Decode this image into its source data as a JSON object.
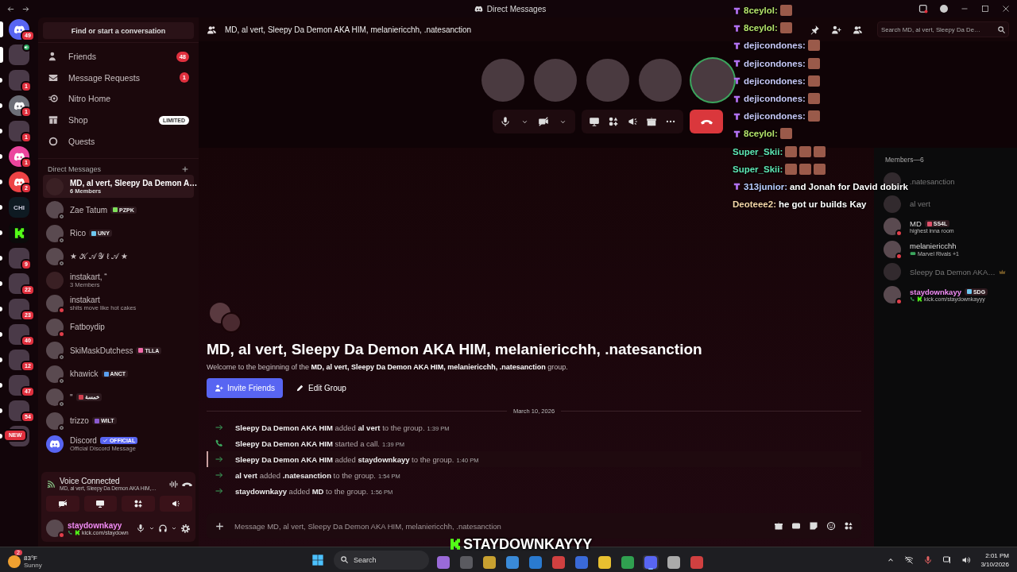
{
  "title_bar": {
    "title": "Direct Messages"
  },
  "servers": [
    {
      "kind": "logo",
      "color": "#5865f2",
      "badge": "49",
      "selected": true,
      "unread": false
    },
    {
      "kind": "picture",
      "selected": true,
      "unread": false,
      "in_voice": true
    },
    {
      "kind": "picture",
      "badge": "1",
      "selected": false,
      "unread": true
    },
    {
      "kind": "logo",
      "color": "#6d6f78",
      "badge": "1",
      "selected": false,
      "unread": true
    },
    {
      "kind": "picture",
      "badge": "1",
      "selected": false,
      "unread": true
    },
    {
      "kind": "logo",
      "color": "#eb459e",
      "badge": "1",
      "selected": false,
      "unread": true
    },
    {
      "kind": "logo",
      "color": "#ed4245",
      "badge": "2",
      "selected": false,
      "unread": true
    },
    {
      "kind": "text",
      "label": "CHI",
      "selected": false,
      "unread": true
    },
    {
      "kind": "kick",
      "selected": false,
      "unread": true
    },
    {
      "kind": "picture",
      "badge": "9",
      "selected": false,
      "unread": true
    },
    {
      "kind": "picture",
      "badge": "22",
      "selected": false,
      "unread": true
    },
    {
      "kind": "picture",
      "badge": "23",
      "selected": false,
      "unread": true
    },
    {
      "kind": "picture",
      "badge": "40",
      "selected": false,
      "unread": true
    },
    {
      "kind": "picture",
      "badge": "12",
      "selected": false,
      "unread": true
    },
    {
      "kind": "picture",
      "badge": "47",
      "selected": false,
      "unread": true
    },
    {
      "kind": "picture",
      "badge": "54",
      "selected": false,
      "unread": true
    },
    {
      "kind": "picture",
      "badge": "NEW",
      "selected": false,
      "unread": true
    }
  ],
  "sidebar": {
    "search": "Find or start a conversation",
    "nav": [
      {
        "kind": "friends",
        "label": "Friends",
        "badge": "48"
      },
      {
        "kind": "requests",
        "label": "Message Requests",
        "badge": "1"
      },
      {
        "kind": "nitro",
        "label": "Nitro Home"
      },
      {
        "kind": "shop",
        "label": "Shop",
        "tag": "LIMITED"
      },
      {
        "kind": "quests",
        "label": "Quests"
      }
    ],
    "dm_header": "Direct Messages",
    "dms": [
      {
        "name": "MD, al vert, Sleepy Da Demon A…",
        "subtitle": "6 Members",
        "group": true,
        "selected": true,
        "offline": false,
        "dnd": false
      },
      {
        "name": "Zae Tatum",
        "tag": {
          "text": "PZPK",
          "color": "#7fe05a"
        },
        "group": false,
        "selected": false,
        "offline": true,
        "dnd": false
      },
      {
        "name": "Rico",
        "tag": {
          "text": "UNY",
          "color": "#6ec8f0"
        },
        "group": false,
        "selected": false,
        "offline": true,
        "dnd": false
      },
      {
        "name": "★ 𝒦 𝒜 𝒴 ℓ 𝒜 ★",
        "group": false,
        "selected": false,
        "offline": true,
        "dnd": false
      },
      {
        "name": "instakart, “",
        "subtitle": "3 Members",
        "group": true,
        "selected": false,
        "offline": false,
        "dnd": false
      },
      {
        "name": "instakart",
        "subtitle": "shits move like hot cakes",
        "group": false,
        "selected": false,
        "offline": false,
        "dnd": true
      },
      {
        "name": "Fatboydip",
        "group": false,
        "selected": false,
        "offline": false,
        "dnd": true
      },
      {
        "name": "SkiMaskDutchess",
        "tag": {
          "text": "TLLA",
          "color": "#f06aa8"
        },
        "group": false,
        "selected": false,
        "offline": true,
        "dnd": false
      },
      {
        "name": "khawick",
        "tag": {
          "text": "ANCT",
          "color": "#5aa0f0"
        },
        "group": false,
        "selected": false,
        "offline": true,
        "dnd": false
      },
      {
        "name": "\"",
        "tag": {
          "text": "خمسة",
          "color": "#d04050"
        },
        "group": false,
        "selected": false,
        "offline": true,
        "dnd": false
      },
      {
        "name": "trizzo",
        "tag": {
          "text": "WILT",
          "color": "#8a5ad0"
        },
        "group": false,
        "selected": false,
        "offline": true,
        "dnd": false
      },
      {
        "name": "Discord",
        "official": "OFFICIAL",
        "subtitle": "Official Discord Message",
        "selected": false,
        "offline": false,
        "dnd": false
      }
    ],
    "voice": {
      "title": "Voice Connected",
      "channel": "MD, al vert, Sleepy Da Demon AKA HIM,…"
    },
    "user": {
      "name": "staydownkayy",
      "activity": "kick.com/staydown",
      "dnd": true
    }
  },
  "header": {
    "title": "MD, al vert, Sleepy Da Demon AKA HIM, melaniericchh, .natesanction",
    "search_placeholder": "Search MD, al vert, Sleepy Da De…"
  },
  "call": {
    "participants": [
      {
        "speaking": false
      },
      {
        "speaking": false
      },
      {
        "speaking": false
      },
      {
        "speaking": false
      },
      {
        "speaking": true
      }
    ],
    "camera": false
  },
  "welcome": {
    "title": "MD, al vert, Sleepy Da Demon AKA HIM, melaniericchh, .natesanction",
    "text": "Welcome to the beginning of the **MD, al vert, Sleepy Da Demon AKA HIM, melaniericchh, .natesanction** group.",
    "buttons": [
      {
        "kind": "invite",
        "label": "Invite Friends"
      },
      {
        "kind": "edit",
        "label": "Edit Group"
      }
    ]
  },
  "date_divider": "March 10, 2026",
  "messages": [
    {
      "kind": "join",
      "text": "**Sleepy Da Demon AKA HIM** added **al vert** to the group.",
      "time": "1:39 PM",
      "highlighted": false
    },
    {
      "kind": "call",
      "text": "**Sleepy Da Demon AKA HIM** started a call.",
      "time": "1:39 PM",
      "highlighted": false
    },
    {
      "kind": "join",
      "text": "**Sleepy Da Demon AKA HIM** added **staydownkayy** to the group.",
      "time": "1:40 PM",
      "highlighted": true
    },
    {
      "kind": "join",
      "text": "**al vert** added **.natesanction** to the group.",
      "time": "1:54 PM",
      "highlighted": false
    },
    {
      "kind": "join",
      "text": "**staydownkayy** added **MD** to the group.",
      "time": "1:56 PM",
      "highlighted": false
    }
  ],
  "composer": {
    "placeholder": "Message MD, al vert, Sleepy Da Demon AKA HIM, melaniericchh, .natesanction"
  },
  "members": {
    "header": "Members—6",
    "items": [
      {
        "name": ".natesanction",
        "offline": true,
        "owner": false,
        "dnd": false
      },
      {
        "name": "al vert",
        "offline": true,
        "owner": false,
        "dnd": false
      },
      {
        "name": "MD",
        "tag": {
          "text": "SS4L",
          "color": "#e0506a"
        },
        "activity": {
          "kind": "text",
          "text": "highest inna room"
        },
        "offline": false,
        "owner": false,
        "dnd": true
      },
      {
        "name": "melaniericchh",
        "activity": {
          "kind": "game",
          "text": "Marvel Rivals +1"
        },
        "offline": false,
        "owner": false,
        "dnd": true
      },
      {
        "name": "Sleepy Da Demon AKA…",
        "offline": true,
        "owner": true,
        "dnd": false
      },
      {
        "name": "staydownkayy",
        "color": "#f28cf5",
        "tag": {
          "text": "SDG",
          "color": "#6ec8f0"
        },
        "activity": {
          "kind": "stream",
          "text": "kick.com/staydownkayyy"
        },
        "offline": false,
        "owner": false,
        "dnd": true
      }
    ]
  },
  "stream_chat": [
    {
      "user": "8ceylol:",
      "color": "#b4e36b",
      "badge": true,
      "parts": [
        {
          "kind": "emote"
        }
      ]
    },
    {
      "user": "8ceylol:",
      "color": "#b4e36b",
      "badge": true,
      "parts": [
        {
          "kind": "emote"
        }
      ]
    },
    {
      "user": "dejicondones:",
      "color": "#c8c8f8",
      "badge": true,
      "parts": [
        {
          "kind": "emote"
        }
      ]
    },
    {
      "user": "dejicondones:",
      "color": "#c8c8f8",
      "badge": true,
      "parts": [
        {
          "kind": "emote"
        }
      ]
    },
    {
      "user": "dejicondones:",
      "color": "#c8c8f8",
      "badge": true,
      "parts": [
        {
          "kind": "emote"
        }
      ]
    },
    {
      "user": "dejicondones:",
      "color": "#c8c8f8",
      "badge": true,
      "parts": [
        {
          "kind": "emote"
        }
      ]
    },
    {
      "user": "dejicondones:",
      "color": "#c8c8f8",
      "badge": true,
      "parts": [
        {
          "kind": "emote"
        }
      ]
    },
    {
      "user": "8ceylol:",
      "color": "#b4e36b",
      "badge": true,
      "parts": [
        {
          "kind": "emote"
        }
      ]
    },
    {
      "user": "Super_Skii:",
      "color": "#5ee6b4",
      "badge": false,
      "parts": [
        {
          "kind": "emote"
        },
        {
          "kind": "emote"
        },
        {
          "kind": "emote"
        }
      ]
    },
    {
      "user": "Super_Skii:",
      "color": "#5ee6b4",
      "badge": false,
      "parts": [
        {
          "kind": "emote"
        },
        {
          "kind": "emote"
        },
        {
          "kind": "emote"
        }
      ]
    },
    {
      "user": "313junior:",
      "color": "#b8ccff",
      "badge": true,
      "parts": [
        {
          "kind": "text",
          "text": "and Jonah for David dobirk"
        }
      ]
    },
    {
      "user": "Deoteee2:",
      "color": "#f6d6a8",
      "badge": false,
      "parts": [
        {
          "kind": "text",
          "text": "he got ur builds Kay"
        }
      ]
    }
  ],
  "stream_label": "STAYDOWNKAYYY",
  "taskbar": {
    "weather": {
      "temp": "83°F",
      "condition": "Sunny",
      "badge": "2"
    },
    "search": "Search",
    "apps": [
      {
        "active": false
      },
      {
        "active": false
      },
      {
        "active": false
      },
      {
        "active": false
      },
      {
        "active": false
      },
      {
        "active": false
      },
      {
        "active": false
      },
      {
        "active": false
      },
      {
        "active": false
      },
      {
        "active": true
      },
      {
        "active": false
      },
      {
        "active": false
      }
    ],
    "time": "2:01 PM",
    "date": "3/10/2026"
  }
}
